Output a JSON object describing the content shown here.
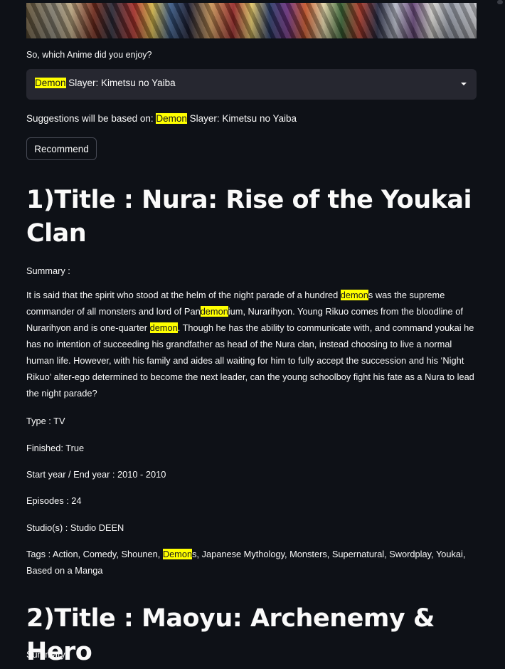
{
  "prompt": {
    "question": "So, which Anime did you enjoy?"
  },
  "select": {
    "value_highlight": "Demon",
    "value_rest": " Slayer: Kimetsu no Yaiba"
  },
  "suggestion": {
    "prefix": "Suggestions will be based on: ",
    "highlight": "Demon",
    "rest": " Slayer: Kimetsu no Yaiba"
  },
  "recommend_button": "Recommend",
  "results": [
    {
      "title": "1)Title : Nura: Rise of the Youkai Clan",
      "summary_label": "Summary :",
      "summary_parts": [
        "It is said that the spirit who stood at the helm of the night parade of a hundred ",
        "demon",
        "s was the supreme commander of all monsters and lord of Pan",
        "demon",
        "ium, Nurarihyon. Young Rikuo comes from the bloodline of Nurarihyon and is one-quarter ",
        "demon",
        ". Though he has the ability to communicate with, and command youkai he has no intention of succeeding his grandfather as head of the Nura clan, instead choosing to live a normal human life. However, with his family and aides all waiting for him to fully accept the succession and his ‘Night Rikuo’ alter-ego determined to become the next leader, can the young schoolboy fight his fate as a Nura to lead the night parade?"
      ],
      "type": "Type : TV",
      "finished": "Finished: True",
      "years": "Start year / End year : 2010 - 2010",
      "episodes": "Episodes : 24",
      "studios": "Studio(s) : Studio DEEN",
      "tags_parts": [
        "Tags : Action, Comedy, Shounen, ",
        "Demon",
        "s, Japanese Mythology, Monsters, Supernatural, Swordplay, Youkai, Based on a Manga"
      ]
    },
    {
      "title": "2)Title : Maoyu: Archenemy & Hero",
      "summary_label": "Summary :"
    }
  ]
}
